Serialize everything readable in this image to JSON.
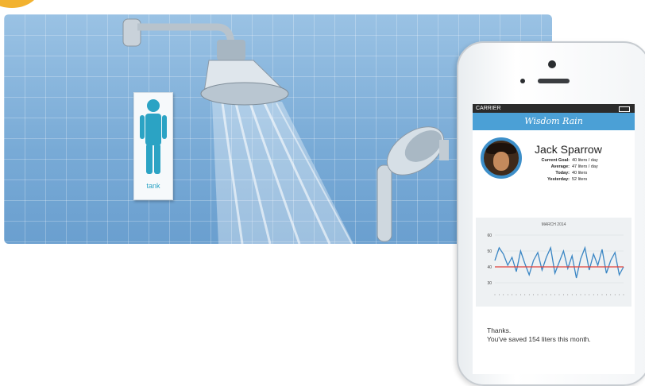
{
  "banner": {
    "sign_label": "tank"
  },
  "phone": {
    "status_carrier": "CARRIER",
    "app_title": "Wisdom Rain",
    "user_name": "Jack Sparrow",
    "stats": [
      {
        "label": "Current Goal:",
        "value": "40 liters / day"
      },
      {
        "label": "Average:",
        "value": "47 liters / day"
      },
      {
        "label": "Today:",
        "value": "40 liters"
      },
      {
        "label": "Yesterday:",
        "value": "52 liters"
      }
    ],
    "message_line1": "Thanks.",
    "message_line2": "You've saved 154 liters this month."
  },
  "colors": {
    "accent": "#4ba0d6",
    "goal_line": "#e0413a",
    "series_line": "#3a86c4"
  },
  "chart_data": {
    "type": "line",
    "title": "MARCH 2014",
    "yticks": [
      "60",
      "50",
      "40",
      "30"
    ],
    "ylim": [
      25,
      62
    ],
    "goal": 40,
    "series": [
      {
        "values": [
          44,
          52,
          48,
          41,
          46,
          37,
          50,
          42,
          35,
          44,
          49,
          38,
          46,
          52,
          36,
          43,
          50,
          39,
          47,
          33,
          45,
          52,
          38,
          48,
          41,
          51,
          36,
          44,
          49,
          35,
          40
        ]
      }
    ]
  }
}
